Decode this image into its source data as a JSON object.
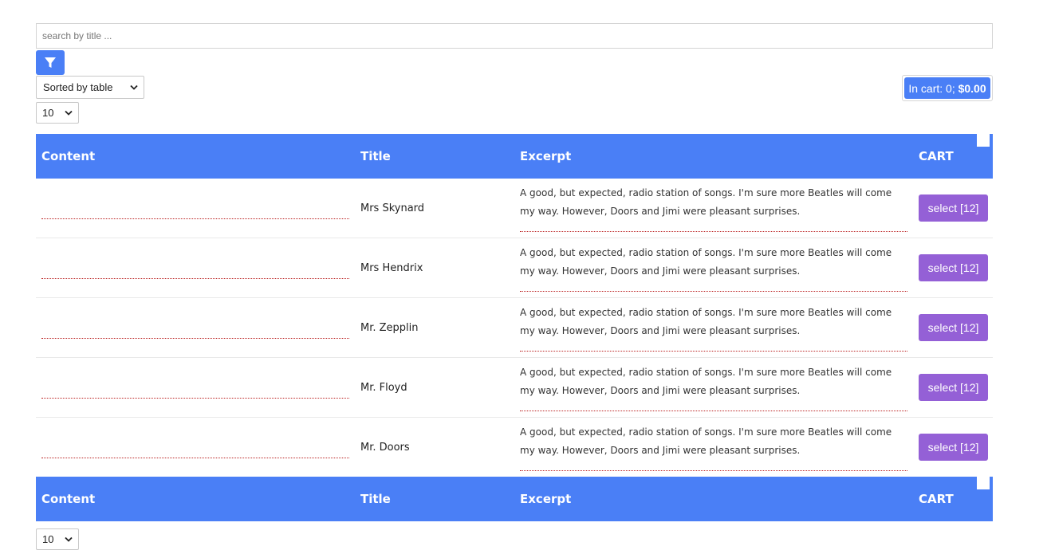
{
  "search": {
    "placeholder": "search by title ..."
  },
  "filter": {
    "icon": "filter-icon"
  },
  "sort": {
    "selected": "Sorted by table"
  },
  "per_page": {
    "selected": "10"
  },
  "cart": {
    "prefix": "In cart: 0; ",
    "total": "$0.00"
  },
  "table": {
    "headers": [
      "Content",
      "Title",
      "Excerpt",
      "CART"
    ],
    "rows": [
      {
        "title": "Mrs Skynard",
        "excerpt": "A good, but expected, radio station of songs. I'm sure more Beatles will come my way. However, Doors and Jimi were pleasant surprises.",
        "button": "select [12]"
      },
      {
        "title": "Mrs Hendrix",
        "excerpt": "A good, but expected, radio station of songs. I'm sure more Beatles will come my way. However, Doors and Jimi were pleasant surprises.",
        "button": "select [12]"
      },
      {
        "title": "Mr. Zepplin",
        "excerpt": "A good, but expected, radio station of songs. I'm sure more Beatles will come my way. However, Doors and Jimi were pleasant surprises.",
        "button": "select [12]"
      },
      {
        "title": "Mr. Floyd",
        "excerpt": "A good, but expected, radio station of songs. I'm sure more Beatles will come my way. However, Doors and Jimi were pleasant surprises.",
        "button": "select [12]"
      },
      {
        "title": "Mr. Doors",
        "excerpt": "A good, but expected, radio station of songs. I'm sure more Beatles will come my way. However, Doors and Jimi were pleasant surprises.",
        "button": "select [12]"
      }
    ]
  },
  "colors": {
    "accent": "#4a7ff6",
    "button": "#9460d6",
    "underline": "#b22222"
  }
}
